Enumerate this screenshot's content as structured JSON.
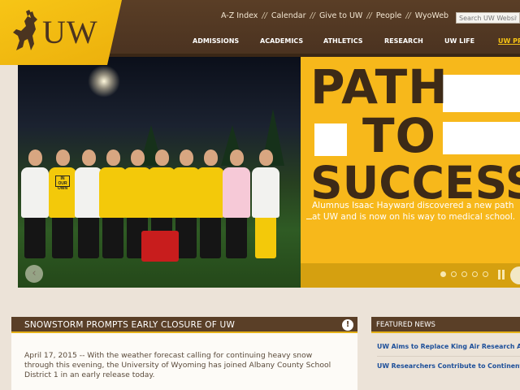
{
  "header": {
    "logo_text": "UW",
    "utility_links": [
      "A-Z Index",
      "Calendar",
      "Give to UW",
      "People",
      "WyoWeb"
    ],
    "separator": "//",
    "search_placeholder": "Search UW Website",
    "nav": [
      "ADMISSIONS",
      "ACADEMICS",
      "ATHLETICS",
      "RESEARCH",
      "UW LIFE",
      "UW PRIDES"
    ]
  },
  "hero": {
    "headline_line1": "PATH",
    "headline_line2": "TO",
    "headline_line3": "SUCCESS",
    "caption": "Alumnus Isaac Hayward discovered a new path at UW and is now on his way to medical school.",
    "shirt_text": "IN OUR OWN",
    "prev_label": "‹",
    "slide_count": 5,
    "active_slide": 0
  },
  "alert": {
    "title": "SNOWSTORM PROMPTS EARLY CLOSURE OF UW",
    "icon": "!",
    "body": "April 17, 2015 -- With the weather forecast calling for continuing heavy snow through this evening, the University of Wyoming has joined Albany County School District 1 in an early release today."
  },
  "featured_news": {
    "title": "FEATURED NEWS",
    "items": [
      "UW Aims to Replace King Air Research Aircraft",
      "UW Researchers Contribute to Continent-Building Discovery"
    ]
  },
  "colors": {
    "brown": "#5a3f27",
    "gold": "#f7b81b",
    "link_blue": "#1d4f9a"
  }
}
